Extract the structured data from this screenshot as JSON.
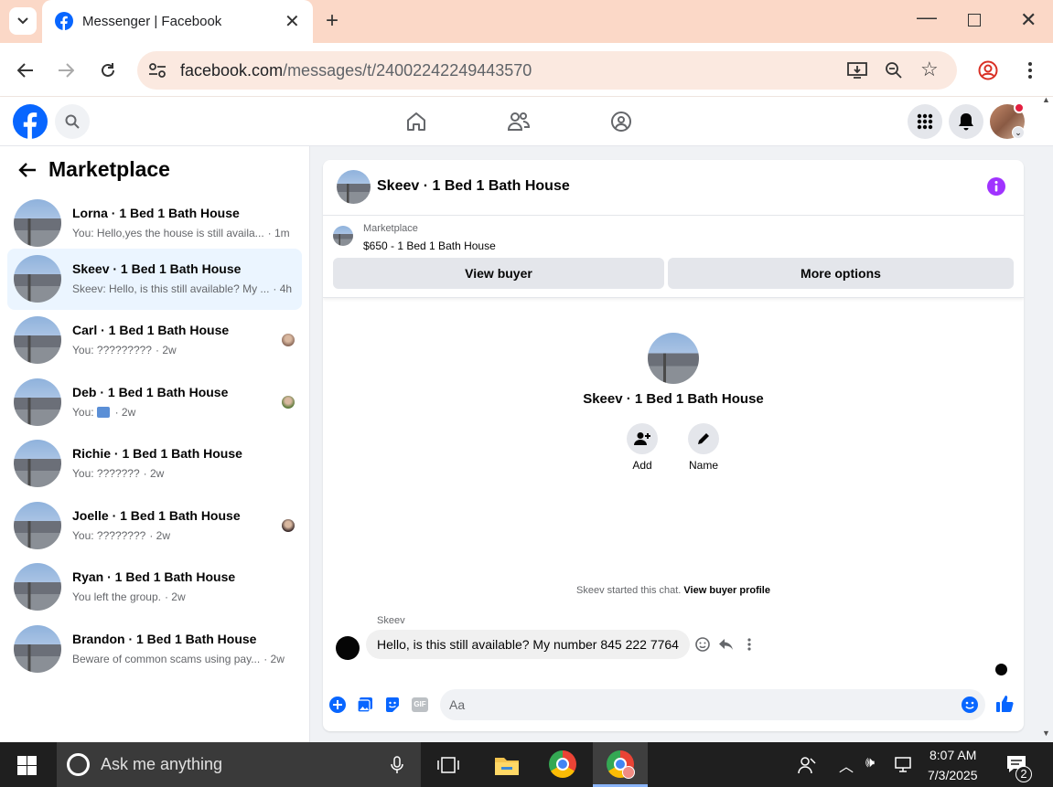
{
  "browser": {
    "tab_title": "Messenger | Facebook",
    "url_host": "facebook.com",
    "url_path": "/messages/t/24002242249443570"
  },
  "sidebar": {
    "title": "Marketplace",
    "conversations": [
      {
        "name": "Lorna · 1 Bed 1 Bath House",
        "preview": "You: Hello,yes the house is still availa...",
        "time": "· 1m"
      },
      {
        "name": "Skeev · 1 Bed 1 Bath House",
        "preview": "Skeev: Hello, is this still available? My ...",
        "time": "· 4h"
      },
      {
        "name": "Carl · 1 Bed 1 Bath House",
        "preview": "You: ?????????",
        "time": "· 2w"
      },
      {
        "name": "Deb · 1 Bed 1 Bath House",
        "preview": "You:",
        "time": "· 2w"
      },
      {
        "name": "Richie · 1 Bed 1 Bath House",
        "preview": "You: ???????",
        "time": "· 2w"
      },
      {
        "name": "Joelle · 1 Bed 1 Bath House",
        "preview": "You: ????????",
        "time": "· 2w"
      },
      {
        "name": "Ryan · 1 Bed 1 Bath House",
        "preview": "You left the group.",
        "time": "· 2w"
      },
      {
        "name": "Brandon · 1 Bed 1 Bath House",
        "preview": "Beware of common scams using pay...",
        "time": "· 2w"
      }
    ]
  },
  "chat": {
    "title": "Skeev · 1 Bed 1 Bath House",
    "listing_source": "Marketplace",
    "listing_title": "$650 - 1 Bed 1 Bath House",
    "view_buyer_label": "View buyer",
    "more_options_label": "More options",
    "profile_name": "Skeev · 1 Bed 1 Bath House",
    "add_label": "Add",
    "name_label": "Name",
    "started_text": "Skeev started this chat.",
    "view_profile_label": "View buyer profile",
    "sender_name": "Skeev",
    "message_text": "Hello, is this still available? My number 845 222 7764",
    "composer_placeholder": "Aa"
  },
  "taskbar": {
    "search_placeholder": "Ask me anything",
    "time": "8:07 AM",
    "date": "7/3/2025",
    "notification_count": "2"
  },
  "colors": {
    "fb_blue": "#0866ff",
    "active_conv": "#ebf5ff",
    "info_purple": "#a033ff",
    "tabstrip": "#fbd8c7"
  },
  "icons": [
    "facebook-logo-icon",
    "search-icon",
    "home-icon",
    "friends-icon",
    "groups-icon",
    "menu-grid-icon",
    "bell-icon",
    "back-arrow-icon",
    "info-icon",
    "add-person-icon",
    "pencil-icon",
    "smile-icon",
    "reply-icon",
    "more-icon",
    "plus-icon",
    "image-icon",
    "sticker-icon",
    "gif-icon",
    "emoji-icon",
    "like-icon"
  ]
}
